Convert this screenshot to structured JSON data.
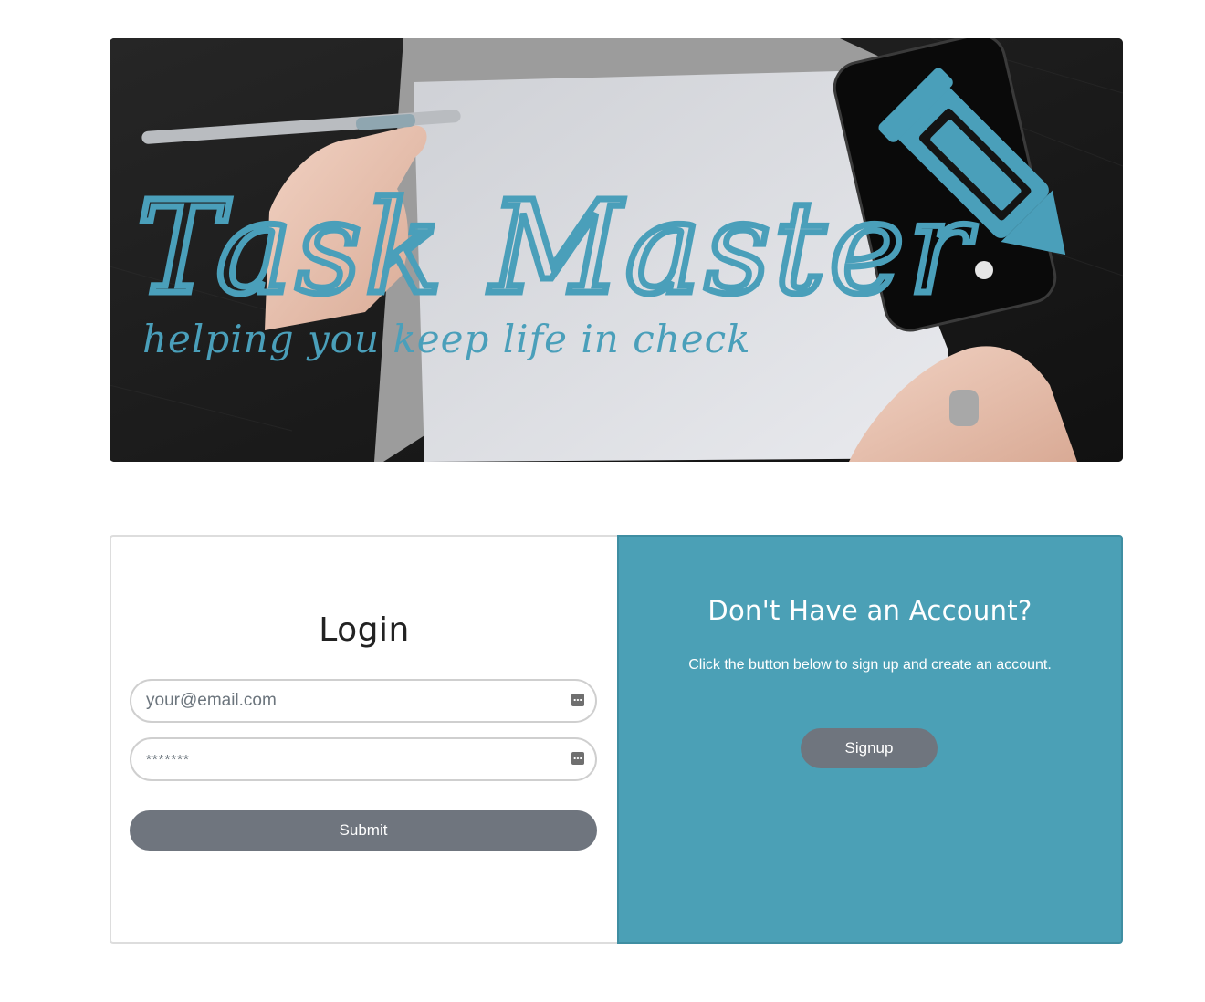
{
  "hero": {
    "title": "Task Master",
    "tagline": "helping you keep life in check"
  },
  "login": {
    "heading": "Login",
    "email_placeholder": "your@email.com",
    "password_placeholder": "*******",
    "submit_label": "Submit"
  },
  "signup": {
    "heading": "Don't Have an Account?",
    "text": "Click the button below to sign up and create an account.",
    "button_label": "Signup"
  },
  "colors": {
    "accent": "#4ba0b6",
    "button": "#6f757e",
    "logo": "#4a9fba"
  }
}
